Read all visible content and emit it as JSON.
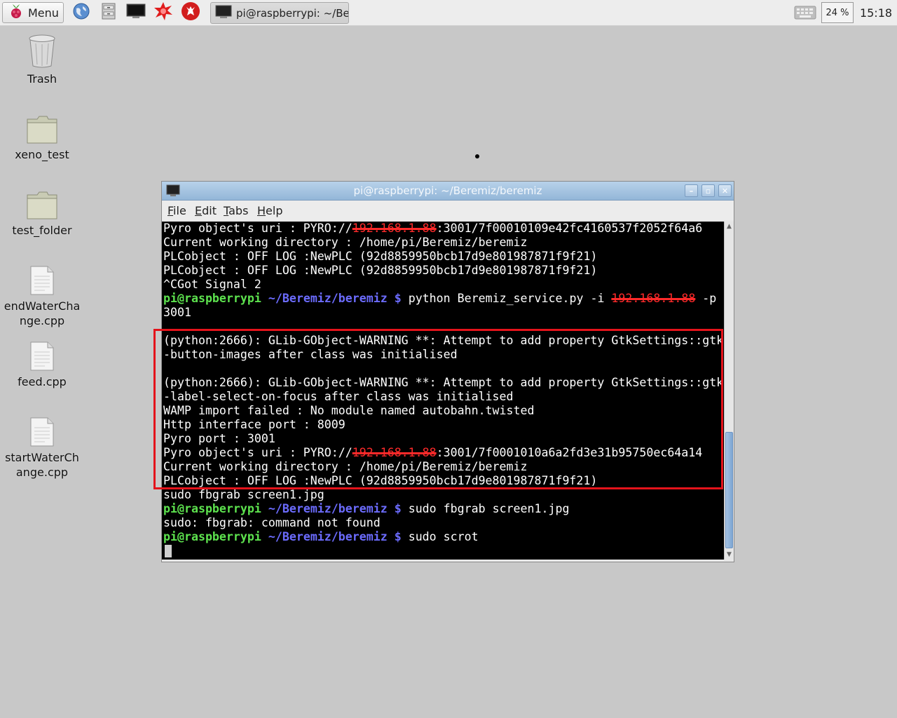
{
  "taskbar": {
    "menu_label": "Menu",
    "launchers": [
      "web-browser-icon",
      "file-manager-icon",
      "terminal-icon",
      "mathematica-icon",
      "wolfram-icon"
    ],
    "task_title": "pi@raspberrypi: ~/Be...",
    "cpu_usage": "24 %",
    "clock": "15:18"
  },
  "desktop": {
    "icons": [
      {
        "label": "Trash",
        "icon": "trash-icon"
      },
      {
        "label": "xeno_test",
        "icon": "folder-icon"
      },
      {
        "label": "test_folder",
        "icon": "folder-icon"
      },
      {
        "label": "endWaterCha\nnge.cpp",
        "icon": "file-icon"
      },
      {
        "label": "feed.cpp",
        "icon": "file-icon"
      },
      {
        "label": "startWaterCh\nange.cpp",
        "icon": "file-icon"
      }
    ]
  },
  "terminal": {
    "title": "pi@raspberrypi: ~/Beremiz/beremiz",
    "menu": [
      {
        "label": "File",
        "mnemonic": "F",
        "rest": "ile"
      },
      {
        "label": "Edit",
        "mnemonic": "E",
        "rest": "dit"
      },
      {
        "label": "Tabs",
        "mnemonic": "T",
        "rest": "abs"
      },
      {
        "label": "Help",
        "mnemonic": "H",
        "rest": "elp"
      }
    ],
    "prompt_user": "pi@raspberrypi",
    "prompt_path": "~/Beremiz/beremiz $",
    "lines": [
      {
        "type": "text_redacted",
        "pre": "Pyro object's uri : PYRO://",
        "redacted": "192.168.1.88",
        "post": ":3001/7f00010109e42fc4160537f2052f64a6"
      },
      {
        "type": "text",
        "text": "Current working directory : /home/pi/Beremiz/beremiz"
      },
      {
        "type": "text",
        "text": "PLCobject : OFF LOG :NewPLC (92d8859950bcb17d9e801987871f9f21)"
      },
      {
        "type": "text",
        "text": "PLCobject : OFF LOG :NewPLC (92d8859950bcb17d9e801987871f9f21)"
      },
      {
        "type": "text",
        "text": "^CGot Signal 2"
      },
      {
        "type": "prompt_redacted",
        "cmd": "python Beremiz_service.py -i ",
        "redacted": "192.168.1.88",
        "post": " -p"
      },
      {
        "type": "text",
        "text": "3001"
      },
      {
        "type": "text",
        "text": ""
      },
      {
        "type": "text",
        "text": "(python:2666): GLib-GObject-WARNING **: Attempt to add property GtkSettings::gtk"
      },
      {
        "type": "text",
        "text": "-button-images after class was initialised"
      },
      {
        "type": "text",
        "text": ""
      },
      {
        "type": "text",
        "text": "(python:2666): GLib-GObject-WARNING **: Attempt to add property GtkSettings::gtk"
      },
      {
        "type": "text",
        "text": "-label-select-on-focus after class was initialised"
      },
      {
        "type": "text",
        "text": "WAMP import failed : No module named autobahn.twisted"
      },
      {
        "type": "text",
        "text": "Http interface port : 8009"
      },
      {
        "type": "text",
        "text": "Pyro port : 3001"
      },
      {
        "type": "text_redacted",
        "pre": "Pyro object's uri : PYRO://",
        "redacted": "192.168.1.88",
        "post": ":3001/7f0001010a6a2fd3e31b95750ec64a14"
      },
      {
        "type": "text",
        "text": "Current working directory : /home/pi/Beremiz/beremiz"
      },
      {
        "type": "text",
        "text": "PLCobject : OFF LOG :NewPLC (92d8859950bcb17d9e801987871f9f21)"
      },
      {
        "type": "text",
        "text": "sudo fbgrab screen1.jpg"
      },
      {
        "type": "prompt",
        "cmd": "sudo fbgrab screen1.jpg"
      },
      {
        "type": "text",
        "text": "sudo: fbgrab: command not found"
      },
      {
        "type": "prompt",
        "cmd": "sudo scrot"
      },
      {
        "type": "cursor"
      }
    ]
  },
  "colors": {
    "prompt_user": "#5de24e",
    "prompt_path": "#6c6cff",
    "highlight_border": "#e4131b",
    "redaction": "#ff2a2a"
  }
}
